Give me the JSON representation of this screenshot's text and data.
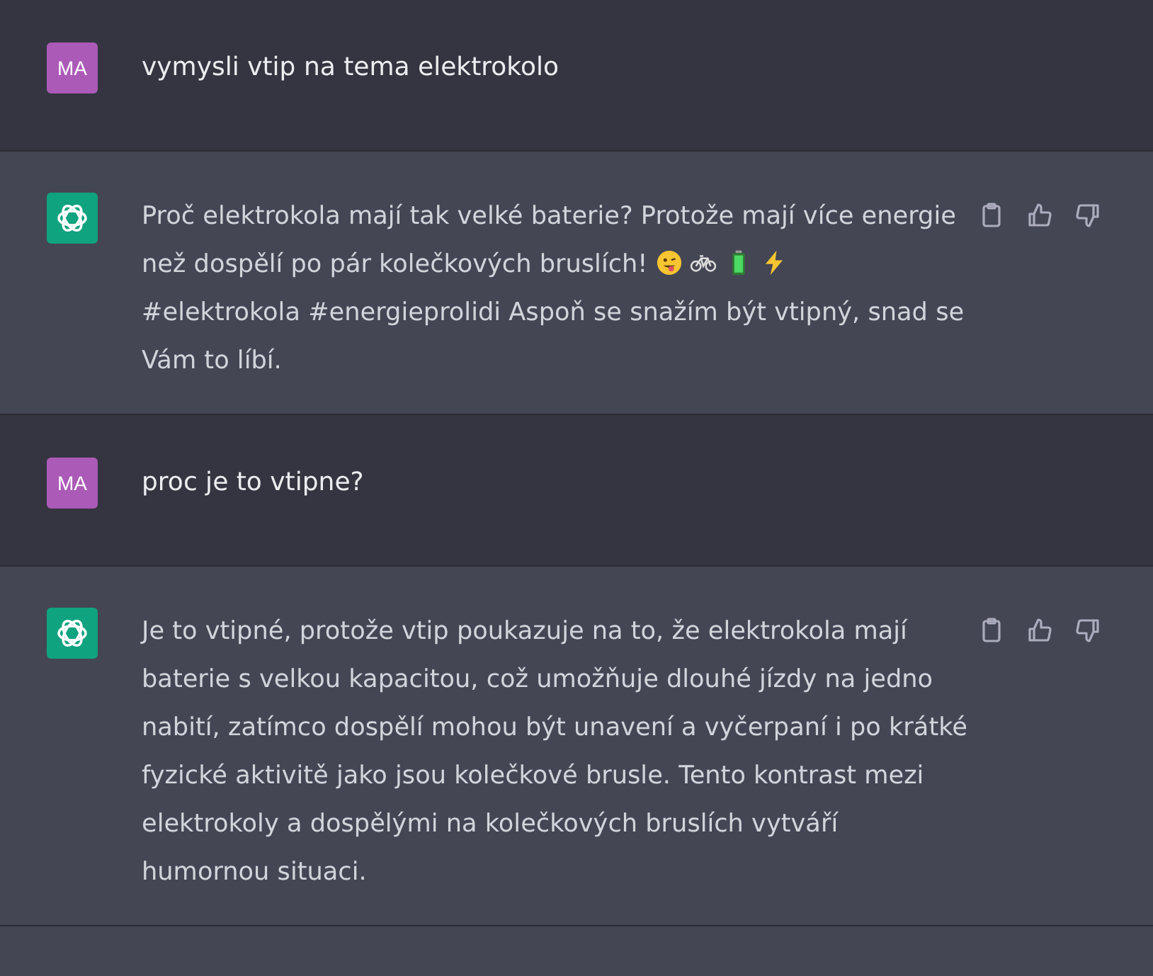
{
  "messages": [
    {
      "kind": "user",
      "avatar": "MA",
      "paragraphs": [
        "vymysli vtip na tema elektrokolo"
      ]
    },
    {
      "kind": "assistant",
      "paragraphs": [
        "Proč elektrokola mají tak velké baterie? Protože mají více energie",
        "než dospělí po pár kolečkových bruslích!",
        "#elektrokola #energieprolidi Aspoň se snažím být vtipný, snad se Vám to líbí."
      ]
    },
    {
      "kind": "user",
      "avatar": "MA",
      "paragraphs": [
        "proc je to vtipne?"
      ]
    },
    {
      "kind": "assistant",
      "paragraphs": [
        "Je to vtipné, protože vtip poukazuje na to, že elektrokola mají baterie s velkou kapacitou, což umožňuje dlouhé jízdy na jedno nabití, zatímco dospělí mohou být unavení a vyčerpaní i po krátké fyzické aktivitě jako jsou kolečkové brusle. Tento kontrast mezi elektrokoly a dospělými na kolečkových bruslích vytváří humornou situaci."
      ]
    }
  ]
}
